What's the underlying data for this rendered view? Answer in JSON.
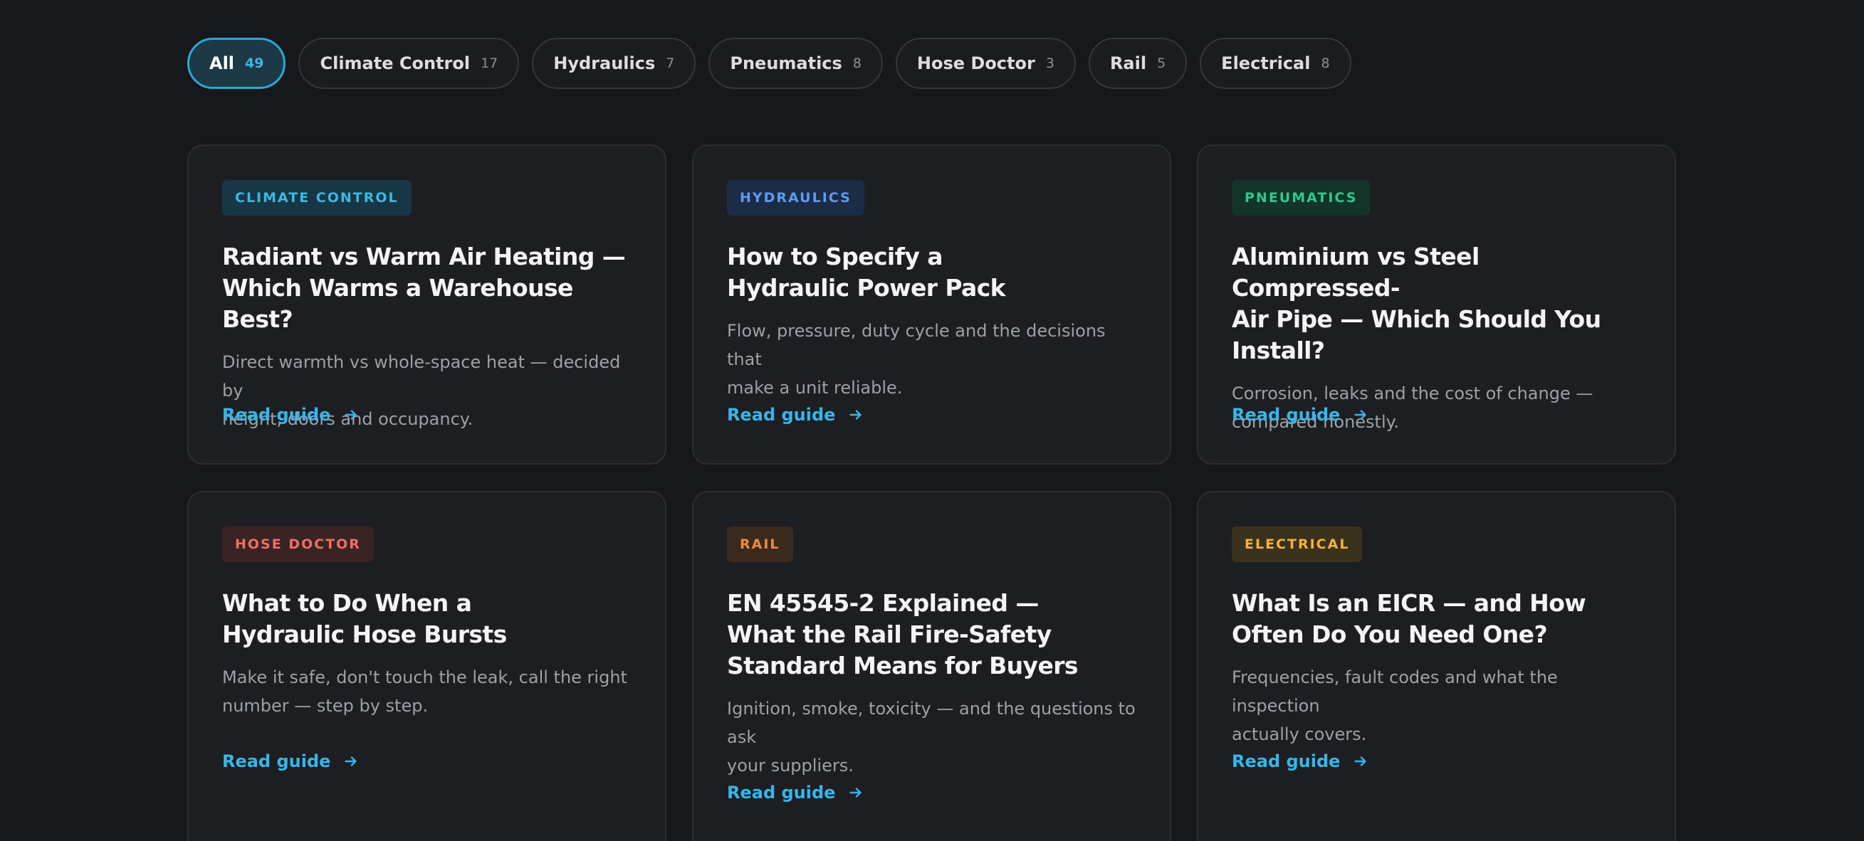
{
  "filters": [
    {
      "label": "All",
      "count": "49",
      "active": true
    },
    {
      "label": "Climate Control",
      "count": "17"
    },
    {
      "label": "Hydraulics",
      "count": "7"
    },
    {
      "label": "Pneumatics",
      "count": "8"
    },
    {
      "label": "Hose Doctor",
      "count": "3"
    },
    {
      "label": "Rail",
      "count": "5"
    },
    {
      "label": "Electrical",
      "count": "8"
    }
  ],
  "cards": [
    {
      "tag": "CLIMATE CONTROL",
      "tag_color": "#3db8e3",
      "tag_bg": "#173746",
      "title": "Radiant vs Warm Air Heating —\nWhich Warms a Warehouse Best?",
      "desc": "Direct warmth vs whole-space heat — decided by\nheight, doors and occupancy.",
      "link": "Read guide"
    },
    {
      "tag": "HYDRAULICS",
      "tag_color": "#5e9cf0",
      "tag_bg": "#1c2b46",
      "title": "How to Specify a\nHydraulic Power Pack",
      "desc": "Flow, pressure, duty cycle and the decisions that\nmake a unit reliable.",
      "link": "Read guide"
    },
    {
      "tag": "PNEUMATICS",
      "tag_color": "#2fc98a",
      "tag_bg": "#133429",
      "title": "Aluminium vs Steel Compressed-\nAir Pipe — Which Should You Install?",
      "desc": "Corrosion, leaks and the cost of change —\ncompared honestly.",
      "link": "Read guide"
    },
    {
      "tag": "HOSE DOCTOR",
      "tag_color": "#ef6f62",
      "tag_bg": "#3a2325",
      "title": "What to Do When a\nHydraulic Hose Bursts",
      "desc": "Make it safe, don't touch the leak, call the right\nnumber — step by step.",
      "link": "Read guide"
    },
    {
      "tag": "RAIL",
      "tag_color": "#f08a3c",
      "tag_bg": "#3a2a1d",
      "title": "EN 45545-2 Explained —\nWhat the Rail Fire-Safety\nStandard Means for Buyers",
      "desc": "Ignition, smoke, toxicity — and the questions to ask\nyour suppliers.",
      "link": "Read guide"
    },
    {
      "tag": "ELECTRICAL",
      "tag_color": "#f0b43a",
      "tag_bg": "#3a321d",
      "title": "What Is an EICR — and How\nOften Do You Need One?",
      "desc": "Frequencies, fault codes and what the inspection\nactually covers.",
      "link": "Read guide"
    }
  ],
  "arrow_icon": "arrow-right-icon",
  "accent": "#36b6ea"
}
